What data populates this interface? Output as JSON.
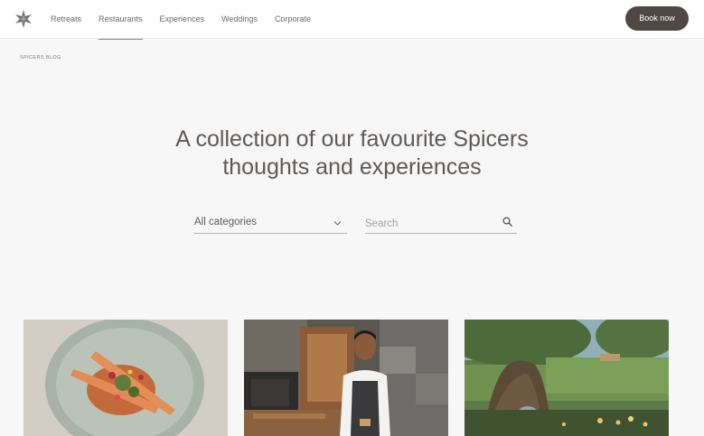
{
  "header": {
    "logo_icon": "spicers-star-logo-icon",
    "nav": [
      {
        "label": "Retreats",
        "active": false
      },
      {
        "label": "Restaurants",
        "active": true
      },
      {
        "label": "Experiences",
        "active": false
      },
      {
        "label": "Weddings",
        "active": false
      },
      {
        "label": "Corporate",
        "active": false
      }
    ],
    "book_label": "Book now"
  },
  "breadcrumb": "SPICERS BLOG",
  "hero": {
    "line1": "A collection of our favourite Spicers",
    "line2": "thoughts and experiences"
  },
  "filters": {
    "category_selected": "All categories",
    "category_icon": "chevron-down-icon",
    "search_placeholder": "Search",
    "search_value": "",
    "search_icon": "search-icon"
  },
  "cards": [
    {
      "image": "plated-dish-photo"
    },
    {
      "image": "chef-portrait-photo"
    },
    {
      "image": "garden-tree-evening-photo"
    }
  ],
  "colors": {
    "accent": "#4f4845",
    "page_background": "#f7f7f7",
    "header_background": "#ffffff"
  }
}
